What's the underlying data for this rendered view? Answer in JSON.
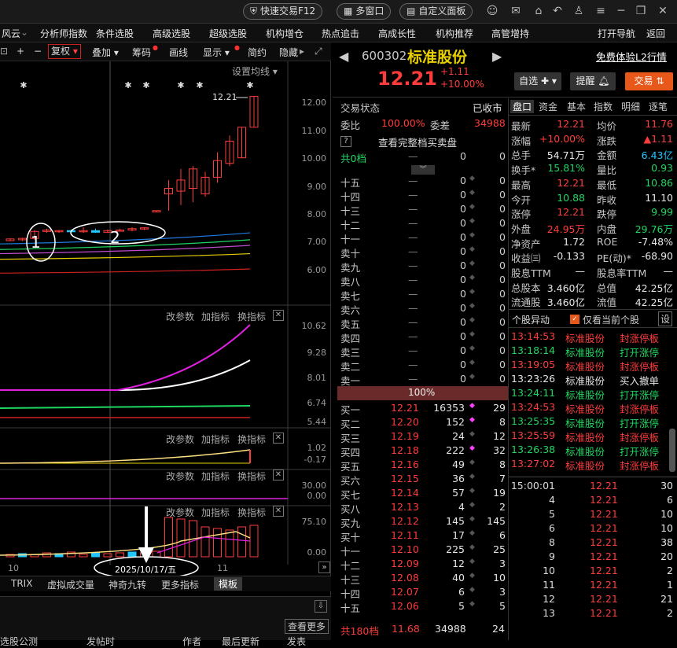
{
  "topbar": {
    "quick_trade": "快速交易F12",
    "multi_window": "多窗口",
    "custom_panel": "自定义面板"
  },
  "menu": {
    "items": [
      "风云",
      "分析师指数",
      "条件选股",
      "高级选股",
      "超级选股",
      "机构增仓",
      "热点追击",
      "高成长性",
      "机构推荐",
      "高管增持"
    ],
    "nav": "打开导航",
    "back": "返回"
  },
  "toolbar": {
    "restore": "复权",
    "overlay": "叠加",
    "chips": "筹码",
    "draw": "画线",
    "display": "显示",
    "simple": "简约",
    "hide": "隐藏"
  },
  "chart": {
    "settings": "设置均线",
    "last_price_label": "12.21",
    "price_axis": [
      "12.00",
      "11.00",
      "10.00",
      "9.00",
      "8.00",
      "7.00",
      "6.00"
    ],
    "candles": [
      {
        "o": 7.02,
        "c": 7.08,
        "h": 7.1,
        "l": 7.0
      },
      {
        "o": 7.05,
        "c": 7.1,
        "h": 7.12,
        "l": 7.0
      },
      {
        "o": 7.1,
        "c": 7.35,
        "h": 7.4,
        "l": 7.05
      },
      {
        "o": 7.35,
        "c": 7.4,
        "h": 7.45,
        "l": 7.3
      },
      {
        "o": 7.35,
        "c": 7.38,
        "h": 7.4,
        "l": 7.3
      },
      {
        "o": 7.38,
        "c": 7.36,
        "h": 7.42,
        "l": 7.3
      },
      {
        "o": 7.36,
        "c": 7.38,
        "h": 7.5,
        "l": 7.3
      },
      {
        "o": 7.38,
        "c": 7.32,
        "h": 7.45,
        "l": 7.3
      },
      {
        "o": 7.32,
        "c": 7.38,
        "h": 7.42,
        "l": 7.3
      },
      {
        "o": 7.38,
        "c": 7.4,
        "h": 7.45,
        "l": 7.35
      },
      {
        "o": 7.4,
        "c": 7.45,
        "h": 7.5,
        "l": 7.35
      },
      {
        "o": 7.45,
        "c": 7.48,
        "h": 7.5,
        "l": 7.4
      },
      {
        "o": 8.05,
        "c": 8.1,
        "h": 8.1,
        "l": 8.05
      },
      {
        "o": 8.7,
        "c": 8.9,
        "h": 9.2,
        "l": 8.1
      },
      {
        "o": 8.8,
        "c": 9.2,
        "h": 9.6,
        "l": 8.3
      },
      {
        "o": 8.9,
        "c": 9.6,
        "h": 9.7,
        "l": 8.4
      },
      {
        "o": 8.7,
        "c": 9.3,
        "h": 9.5,
        "l": 8.6
      },
      {
        "o": 9.3,
        "c": 9.9,
        "h": 10.2,
        "l": 9.1
      },
      {
        "o": 9.8,
        "c": 10.6,
        "h": 10.8,
        "l": 9.7
      },
      {
        "o": 10.0,
        "c": 11.1,
        "h": 11.1,
        "l": 10.0
      },
      {
        "o": 11.1,
        "c": 12.21,
        "h": 12.21,
        "l": 11.1
      }
    ],
    "circle_labels": [
      "1",
      "2"
    ],
    "panel2": {
      "edit": "改参数",
      "add": "加指标",
      "change": "换指标",
      "axis": [
        "10.62",
        "9.28",
        "8.01",
        "6.74",
        "5.44"
      ]
    },
    "panel3": {
      "edit": "改参数",
      "add": "加指标",
      "change": "换指标",
      "axis": [
        "1.02",
        "-0.17"
      ]
    },
    "panel4": {
      "edit": "改参数",
      "add": "加指标",
      "change": "换指标",
      "axis": [
        "30.00",
        "0.00"
      ]
    },
    "panel5": {
      "edit": "改参数",
      "add": "加指标",
      "change": "换指标",
      "axis": [
        "75.10",
        "0.00"
      ]
    },
    "date_label": "2025/10/17/五",
    "x_labels": [
      "10",
      "11"
    ],
    "tabs": [
      "TRIX",
      "虚拟成交量",
      "神奇九转",
      "更多指标",
      "模板"
    ],
    "bottom": {
      "see_more": "查看更多",
      "col1": "选股公测",
      "col2": "发帖时",
      "col3": "作者",
      "col4": "最后更新",
      "col5": "发表"
    }
  },
  "quote": {
    "code": "600302",
    "name": "标准股份",
    "price": "12.21",
    "change": "+1.11",
    "pct": "+10.00%",
    "l2": "免费体验L2行情",
    "watch": "自选",
    "alert": "提醒",
    "trade": "交易"
  },
  "orderbook": {
    "status_label": "交易状态",
    "status": "已收市",
    "ratio_label": "委比",
    "ratio": "100.00%",
    "diff_label": "委差",
    "diff": "34988",
    "full_link": "查看完整档买卖盘",
    "total_label": "共0档",
    "sells": [
      "十五",
      "十四",
      "十三",
      "十二",
      "十一",
      "卖十",
      "卖九",
      "卖八",
      "卖七",
      "卖六",
      "卖五",
      "卖四",
      "卖三",
      "卖二",
      "卖一"
    ],
    "progress": "100%",
    "buys": [
      {
        "l": "买一",
        "p": "12.21",
        "v": "16353",
        "n": "29"
      },
      {
        "l": "买二",
        "p": "12.20",
        "v": "152",
        "n": "8"
      },
      {
        "l": "买三",
        "p": "12.19",
        "v": "24",
        "n": "12"
      },
      {
        "l": "买四",
        "p": "12.18",
        "v": "222",
        "n": "32"
      },
      {
        "l": "买五",
        "p": "12.16",
        "v": "49",
        "n": "8"
      },
      {
        "l": "买六",
        "p": "12.15",
        "v": "36",
        "n": "7"
      },
      {
        "l": "买七",
        "p": "12.14",
        "v": "57",
        "n": "19"
      },
      {
        "l": "买八",
        "p": "12.13",
        "v": "4",
        "n": "2"
      },
      {
        "l": "买九",
        "p": "12.12",
        "v": "145",
        "n": "145"
      },
      {
        "l": "买十",
        "p": "12.11",
        "v": "17",
        "n": "6"
      },
      {
        "l": "十一",
        "p": "12.10",
        "v": "225",
        "n": "25"
      },
      {
        "l": "十二",
        "p": "12.09",
        "v": "12",
        "n": "3"
      },
      {
        "l": "十三",
        "p": "12.08",
        "v": "40",
        "n": "10"
      },
      {
        "l": "十四",
        "p": "12.07",
        "v": "6",
        "n": "3"
      },
      {
        "l": "十五",
        "p": "12.06",
        "v": "5",
        "n": "5"
      }
    ],
    "foot_label": "共180档",
    "foot_price": "11.68",
    "foot_vol": "34988",
    "foot_n": "24"
  },
  "tabs": [
    "盘口",
    "资金",
    "基本",
    "指数",
    "明细",
    "逐笔"
  ],
  "stats": [
    {
      "a": "最新",
      "av": "12.21",
      "b": "均价",
      "bv": "11.76"
    },
    {
      "a": "涨幅",
      "av": "+10.00%",
      "b": "涨跌",
      "bv": "▲1.11"
    },
    {
      "a": "总手",
      "av": "54.71万",
      "b": "金额",
      "bv": "6.43亿"
    },
    {
      "a": "换手*",
      "av": "15.81%",
      "b": "量比",
      "bv": "0.93"
    },
    {
      "a": "最高",
      "av": "12.21",
      "b": "最低",
      "bv": "10.86"
    },
    {
      "a": "今开",
      "av": "10.88",
      "b": "昨收",
      "bv": "11.10"
    },
    {
      "a": "涨停",
      "av": "12.21",
      "b": "跌停",
      "bv": "9.99"
    },
    {
      "a": "外盘",
      "av": "24.95万",
      "b": "内盘",
      "bv": "29.76万"
    },
    {
      "a": "净资产",
      "av": "1.72",
      "b": "ROE",
      "bv": "-7.48%"
    },
    {
      "a": "收益㈢",
      "av": "-0.133",
      "b": "PE(动)*",
      "bv": "-68.90"
    },
    {
      "a": "股息TTM",
      "av": "—",
      "b": "股息率TTM",
      "bv": "—"
    },
    {
      "a": "总股本",
      "av": "3.460亿",
      "b": "总值",
      "bv": "42.25亿"
    },
    {
      "a": "流通股",
      "av": "3.460亿",
      "b": "流值",
      "bv": "42.25亿"
    }
  ],
  "anomaly": {
    "title": "个股异动",
    "only_current": "仅看当前个股",
    "settings": "设",
    "rows": [
      {
        "t": "13:14:53",
        "s": "标准股份",
        "e": "封涨停板",
        "c": "red"
      },
      {
        "t": "13:18:14",
        "s": "标准股份",
        "e": "打开涨停",
        "c": "grn"
      },
      {
        "t": "13:19:05",
        "s": "标准股份",
        "e": "封涨停板",
        "c": "red"
      },
      {
        "t": "13:23:26",
        "s": "标准股份",
        "e": "买入撤单",
        "c": "wht"
      },
      {
        "t": "13:24:11",
        "s": "标准股份",
        "e": "打开涨停",
        "c": "grn"
      },
      {
        "t": "13:24:53",
        "s": "标准股份",
        "e": "封涨停板",
        "c": "red"
      },
      {
        "t": "13:25:35",
        "s": "标准股份",
        "e": "打开涨停",
        "c": "grn"
      },
      {
        "t": "13:25:59",
        "s": "标准股份",
        "e": "封涨停板",
        "c": "red"
      },
      {
        "t": "13:26:38",
        "s": "标准股份",
        "e": "打开涨停",
        "c": "grn"
      },
      {
        "t": "13:27:02",
        "s": "标准股份",
        "e": "封涨停板",
        "c": "red"
      }
    ]
  },
  "ticks": [
    {
      "t": "15:00:01",
      "p": "12.21",
      "v": "30"
    },
    {
      "t": "4",
      "p": "12.21",
      "v": "6"
    },
    {
      "t": "5",
      "p": "12.21",
      "v": "10"
    },
    {
      "t": "6",
      "p": "12.21",
      "v": "10"
    },
    {
      "t": "8",
      "p": "12.21",
      "v": "38"
    },
    {
      "t": "9",
      "p": "12.21",
      "v": "20"
    },
    {
      "t": "10",
      "p": "12.21",
      "v": "2"
    },
    {
      "t": "11",
      "p": "12.21",
      "v": "1"
    },
    {
      "t": "12",
      "p": "12.21",
      "v": "21"
    },
    {
      "t": "13",
      "p": "12.21",
      "v": "2"
    }
  ]
}
